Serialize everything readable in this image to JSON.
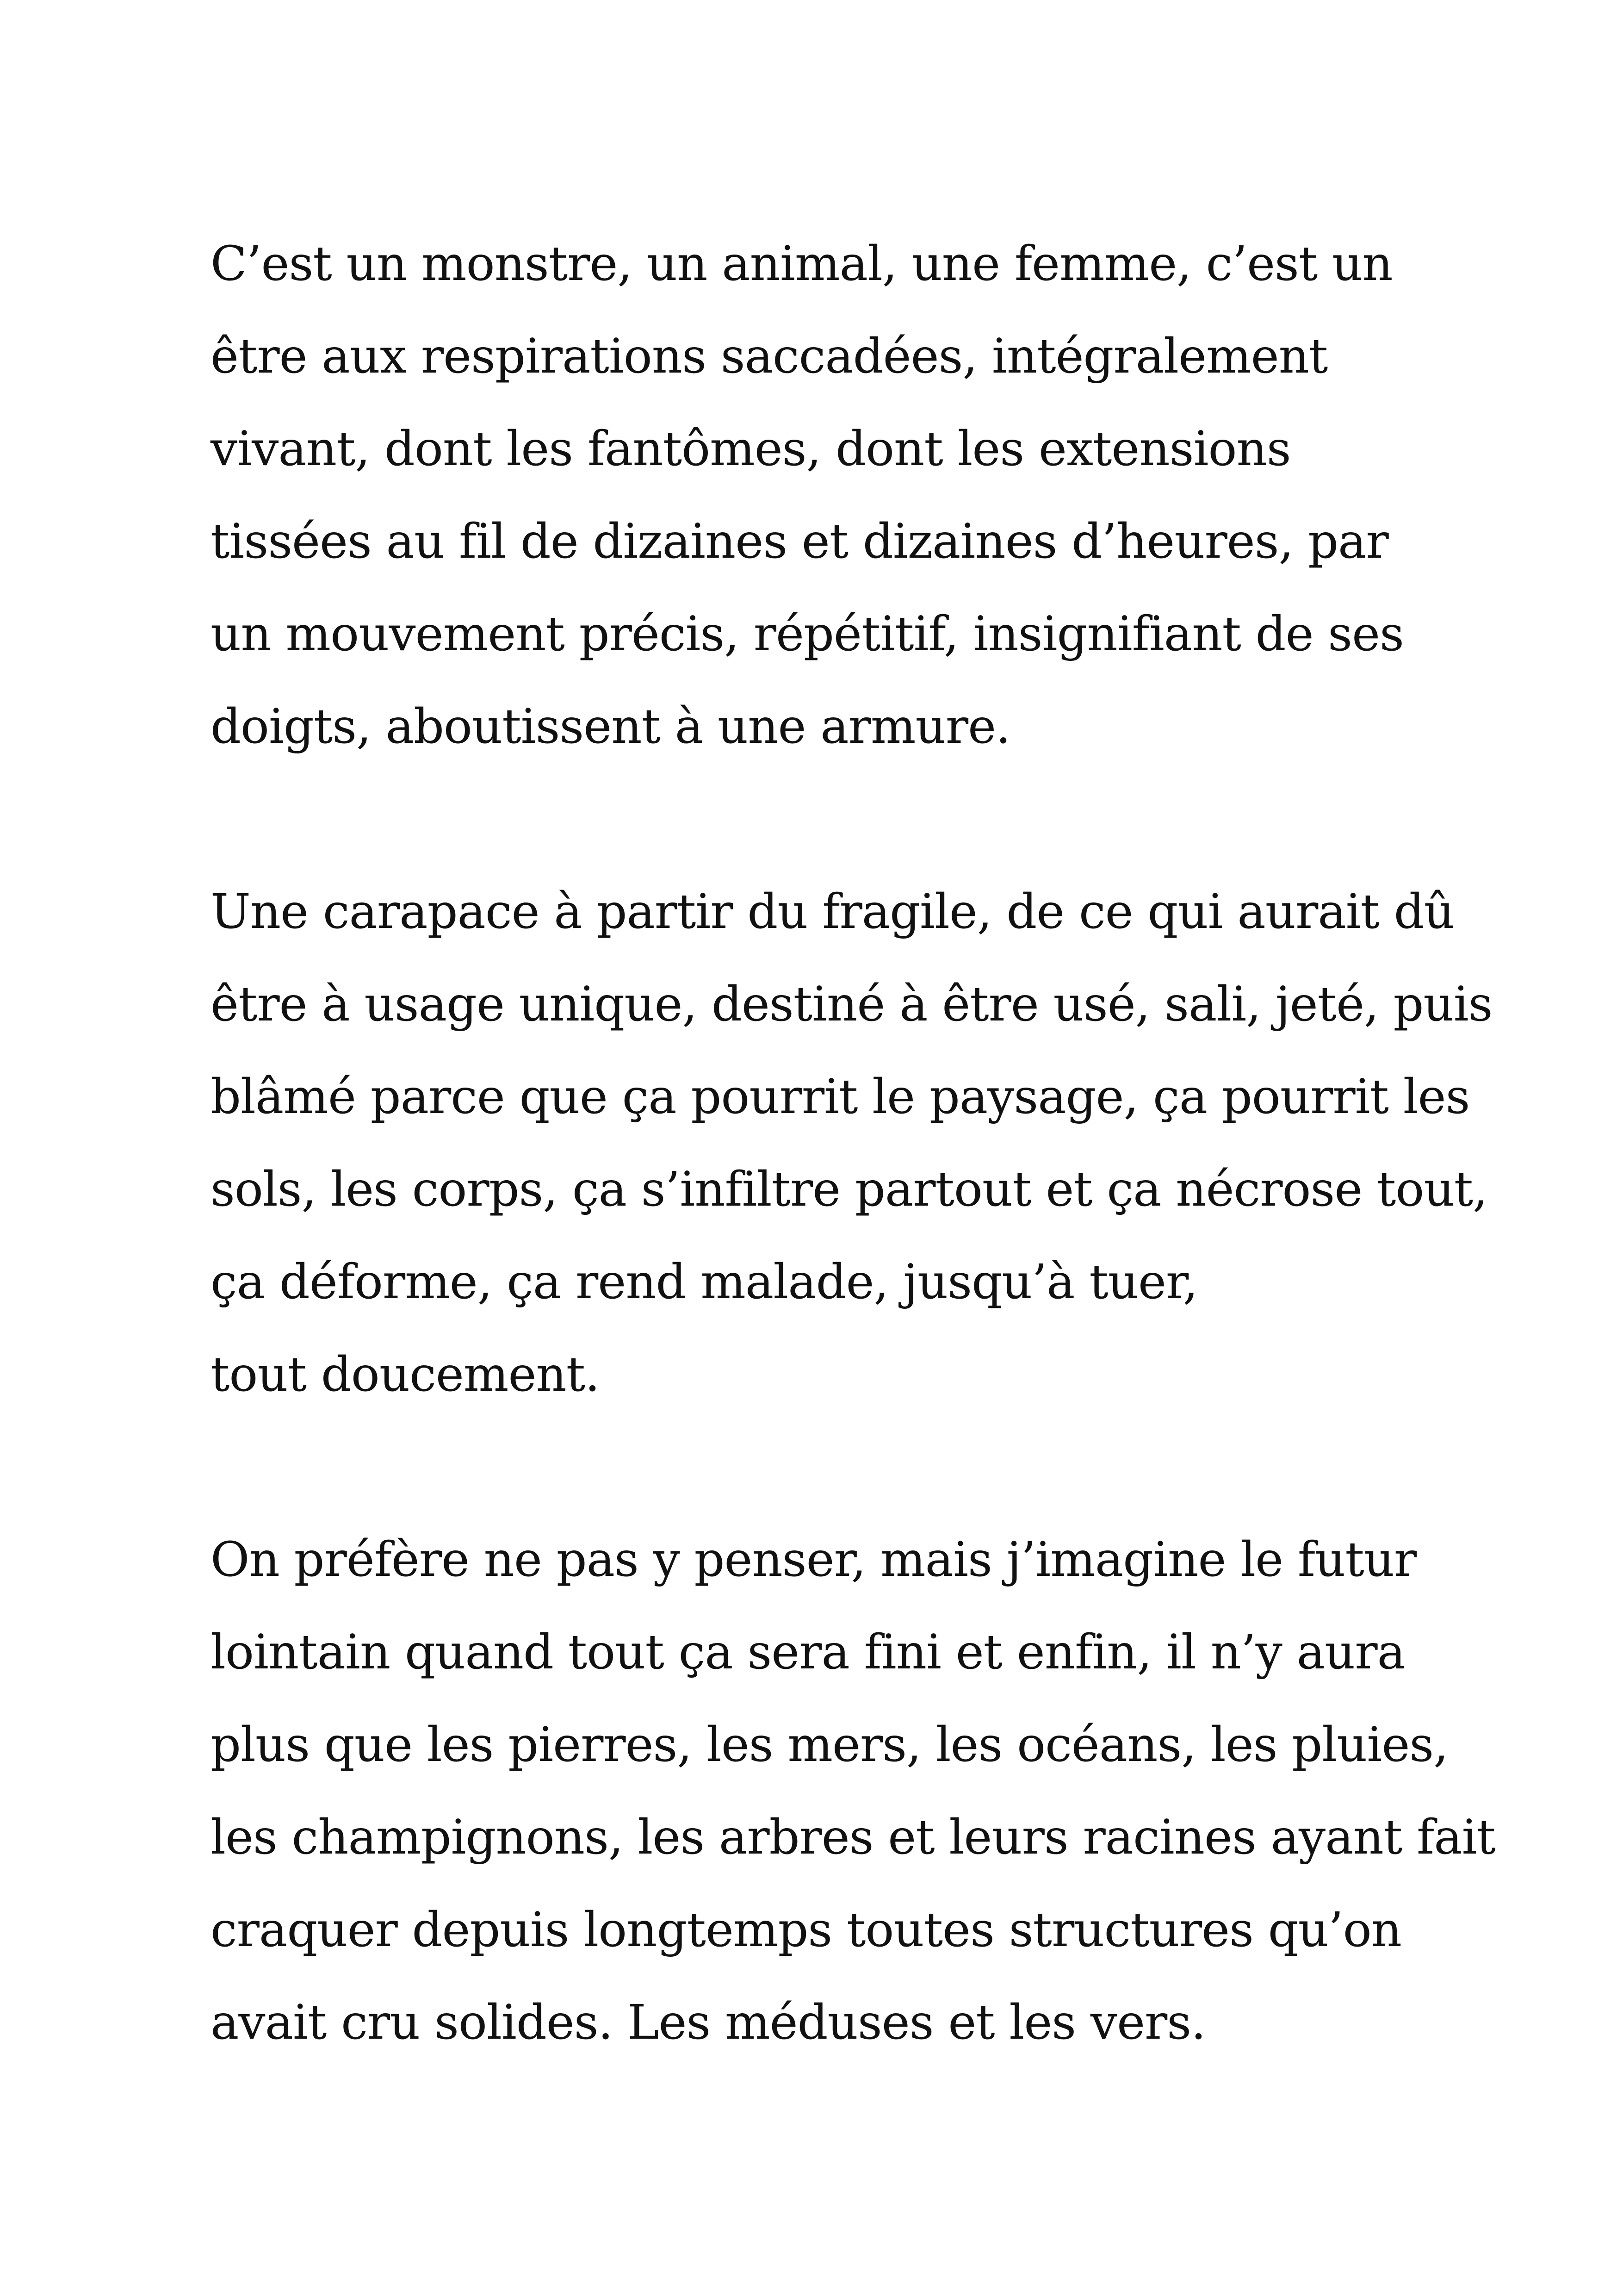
{
  "document": {
    "paragraphs": [
      {
        "lines": [
          "C’est un monstre, un animal, une femme, c’est un",
          "être aux respirations saccadées, intégralement",
          "vivant, dont les fantômes, dont les extensions",
          "tissées au fil de dizaines et dizaines d’heures, par",
          "un mouvement précis, répétitif, insignifiant de ses",
          "doigts, aboutissent à une armure."
        ]
      },
      {
        "lines": [
          "Une carapace à partir du fragile, de ce qui aurait dû",
          "être à usage unique, destiné à être usé, sali, jeté, puis",
          "blâmé parce que ça pourrit le paysage, ça pourrit les",
          "sols, les corps, ça s’infiltre partout et ça nécrose tout,",
          "ça déforme, ça rend malade, jusqu’à tuer,",
          "tout doucement."
        ]
      },
      {
        "lines": [
          "On préfère ne pas y penser, mais j’imagine le futur",
          "lointain quand tout ça sera fini et enfin, il n’y aura",
          "plus que les pierres, les mers, les océans, les pluies,",
          "les champignons, les arbres et leurs racines ayant fait",
          "craquer depuis longtemps toutes structures qu’on",
          "avait cru solides. Les méduses et les vers."
        ]
      }
    ]
  }
}
